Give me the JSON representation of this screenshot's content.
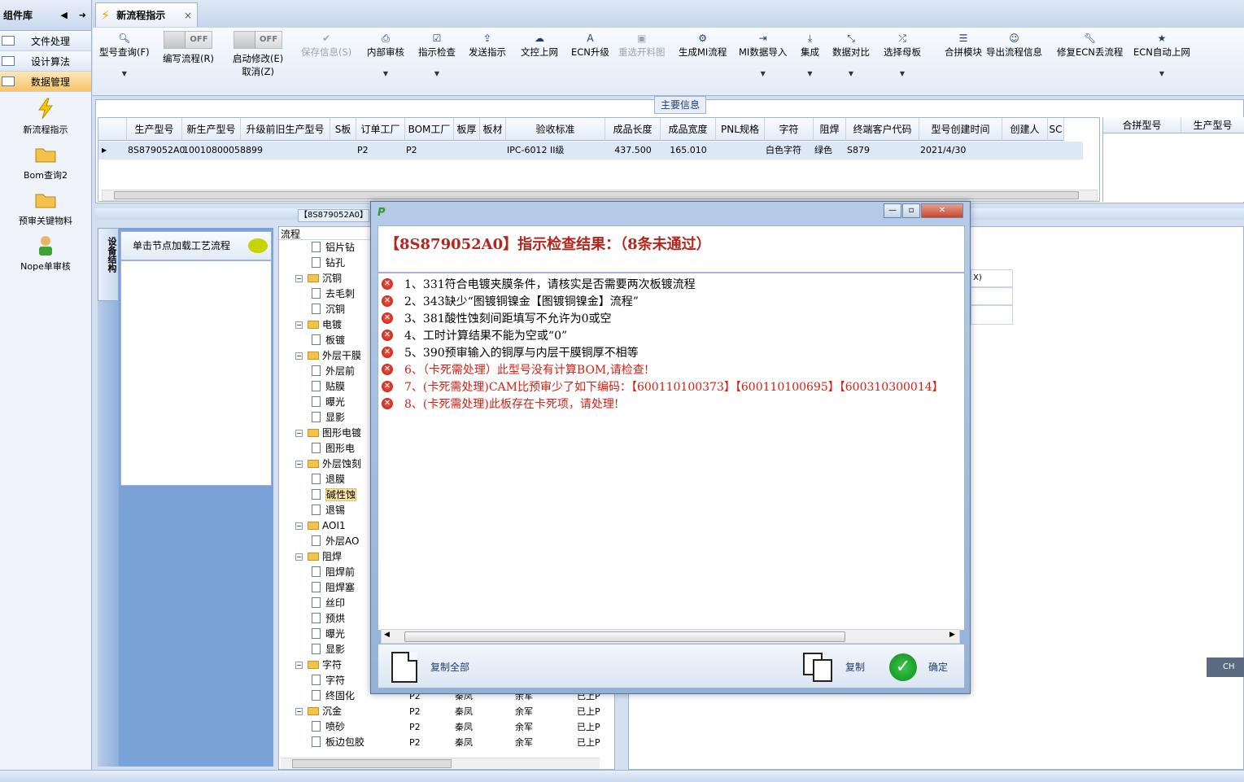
{
  "left_panel": {
    "title": "组件库",
    "items": [
      {
        "label": "文件处理"
      },
      {
        "label": "设计算法"
      },
      {
        "label": "数据管理"
      }
    ],
    "tools": [
      {
        "label": "新流程指示",
        "icon": "lightning-icon"
      },
      {
        "label": "Bom查询2",
        "icon": "folder-icon"
      },
      {
        "label": "预审关键物料",
        "icon": "folder-icon"
      },
      {
        "label": "Nope单审核",
        "icon": "user-icon"
      }
    ]
  },
  "tab": {
    "label": "新流程指示",
    "close": "×"
  },
  "toolbar": {
    "buttons": [
      {
        "label": "型号查询(F)",
        "icon": "search-icon"
      },
      {
        "label": "编写流程(R)",
        "toggle": "OFF"
      },
      {
        "label": "启动修改(E)",
        "label2": "取消(Z)",
        "toggle": "OFF"
      },
      {
        "label": "保存信息(S)",
        "icon": "check-icon"
      },
      {
        "label": "内部审核",
        "icon": "printer-icon"
      },
      {
        "label": "指示检查",
        "icon": "checkbox-icon"
      },
      {
        "label": "发送指示",
        "icon": "upload-icon"
      },
      {
        "label": "文控上网",
        "icon": "cloud-icon"
      },
      {
        "label": "ECN升级",
        "icon": "a-icon"
      },
      {
        "label": "重选开料图",
        "icon": "image-icon"
      },
      {
        "label": "生成MI流程",
        "icon": "gears-icon"
      },
      {
        "label": "MI数据导入",
        "icon": "import-icon"
      },
      {
        "label": "集成",
        "icon": "download-icon"
      },
      {
        "label": "数据对比",
        "icon": "compare-icon"
      },
      {
        "label": "选择母板",
        "icon": "shuffle-icon"
      },
      {
        "label": "合拼模块",
        "icon": "list-icon"
      },
      {
        "label": "导出流程信息",
        "icon": "smile-icon"
      },
      {
        "label": "修复ECN丢流程",
        "icon": "wrench-icon"
      },
      {
        "label": "ECN自动上网",
        "icon": "star-icon"
      }
    ]
  },
  "main_info": {
    "title": "主要信息",
    "columns": [
      "生产型号",
      "新生产型号",
      "升级前旧生产型号",
      "S板",
      "订单工厂",
      "BOM工厂",
      "板厚",
      "板材",
      "验收标准",
      "成品长度",
      "成品宽度",
      "PNL规格",
      "字符",
      "阻焊",
      "终端客户代码",
      "型号创建时间",
      "创建人",
      "SC"
    ],
    "row": [
      "8S879052A0",
      "10010800058899",
      "",
      "",
      "P2",
      "P2",
      "",
      "",
      "IPC-6012 II级",
      "437.500",
      "165.010",
      "",
      "白色字符",
      "绿色",
      "S879",
      "2021/4/30",
      "",
      ""
    ],
    "right_columns": [
      "合拼型号",
      "生产型号"
    ]
  },
  "lower": {
    "vertical_tab": "设备结构",
    "node_hint": "单击节点加载工艺流程",
    "tree_tab": "【8S879052A0】",
    "tree_header": "流程",
    "tree": [
      {
        "type": "leaf",
        "label": "铝片钻"
      },
      {
        "type": "leaf",
        "label": "钻孔"
      },
      {
        "type": "folder",
        "label": "沉铜"
      },
      {
        "type": "leaf",
        "label": "去毛刺"
      },
      {
        "type": "leaf",
        "label": "沉铜"
      },
      {
        "type": "folder",
        "label": "电镀"
      },
      {
        "type": "leaf",
        "label": "板镀"
      },
      {
        "type": "folder",
        "label": "外层干膜"
      },
      {
        "type": "leaf",
        "label": "外层前"
      },
      {
        "type": "leaf",
        "label": "贴膜"
      },
      {
        "type": "leaf",
        "label": "曝光"
      },
      {
        "type": "leaf",
        "label": "显影"
      },
      {
        "type": "folder",
        "label": "图形电镀"
      },
      {
        "type": "leaf",
        "label": "图形电"
      },
      {
        "type": "folder",
        "label": "外层蚀刻"
      },
      {
        "type": "leaf",
        "label": "退膜"
      },
      {
        "type": "leaf",
        "label": "碱性蚀",
        "selected": true
      },
      {
        "type": "leaf",
        "label": "退锡"
      },
      {
        "type": "folder",
        "label": "AOI1"
      },
      {
        "type": "leaf",
        "label": "外层AO"
      },
      {
        "type": "folder",
        "label": "阻焊"
      },
      {
        "type": "leaf",
        "label": "阻焊前"
      },
      {
        "type": "leaf",
        "label": "阻焊塞"
      },
      {
        "type": "leaf",
        "label": "丝印"
      },
      {
        "type": "leaf",
        "label": "预烘"
      },
      {
        "type": "leaf",
        "label": "曝光"
      },
      {
        "type": "leaf",
        "label": "显影"
      },
      {
        "type": "folder",
        "label": "字符"
      },
      {
        "type": "leaf",
        "label": "字符"
      },
      {
        "type": "leaf",
        "label": "终固化",
        "cols": [
          "P2",
          "秦凤",
          "余军",
          "已上P"
        ]
      },
      {
        "type": "folder",
        "label": "沉金",
        "cols": [
          "P2",
          "秦凤",
          "余军",
          "已上P"
        ]
      },
      {
        "type": "leaf",
        "label": "喷砂",
        "cols": [
          "P2",
          "秦凤",
          "余军",
          "已上P"
        ]
      },
      {
        "type": "leaf",
        "label": "板边包胶",
        "cols": [
          "P2",
          "秦凤",
          "余军",
          "已上P"
        ]
      }
    ],
    "right_snippet": "X)"
  },
  "dialog": {
    "title_head": "【8S879052A0】指示检查结果：（8条未通过）",
    "items": [
      {
        "text": "1、331符合电镀夹膜条件，请核实是否需要两次板镀流程",
        "severity": "normal"
      },
      {
        "text": "2、343缺少“图镀铜镍金【图镀铜镍金】流程”",
        "severity": "normal"
      },
      {
        "text": "3、381酸性蚀刻间距填写不允许为0或空",
        "severity": "normal"
      },
      {
        "text": "4、工时计算结果不能为空或“0”",
        "severity": "normal"
      },
      {
        "text": "5、390预审输入的铜厚与内层干膜铜厚不相等",
        "severity": "normal"
      },
      {
        "text": "6、（卡死需处理）此型号没有计算BOM,请检查!",
        "severity": "critical"
      },
      {
        "text": "7、(卡死需处理)CAM比预审少了如下编码：【600110100373】【600110100695】【600310300014】",
        "severity": "critical"
      },
      {
        "text": "8、(卡死需处理)此板存在卡死项，请处理!",
        "severity": "critical"
      }
    ],
    "copy_all": "复制全部",
    "copy": "复制",
    "ok": "确定"
  },
  "status": {
    "ime": "CH"
  },
  "colors": {
    "critical": "#d81e12",
    "header_red": "#b3261e",
    "accent": "#1d3d6e"
  }
}
